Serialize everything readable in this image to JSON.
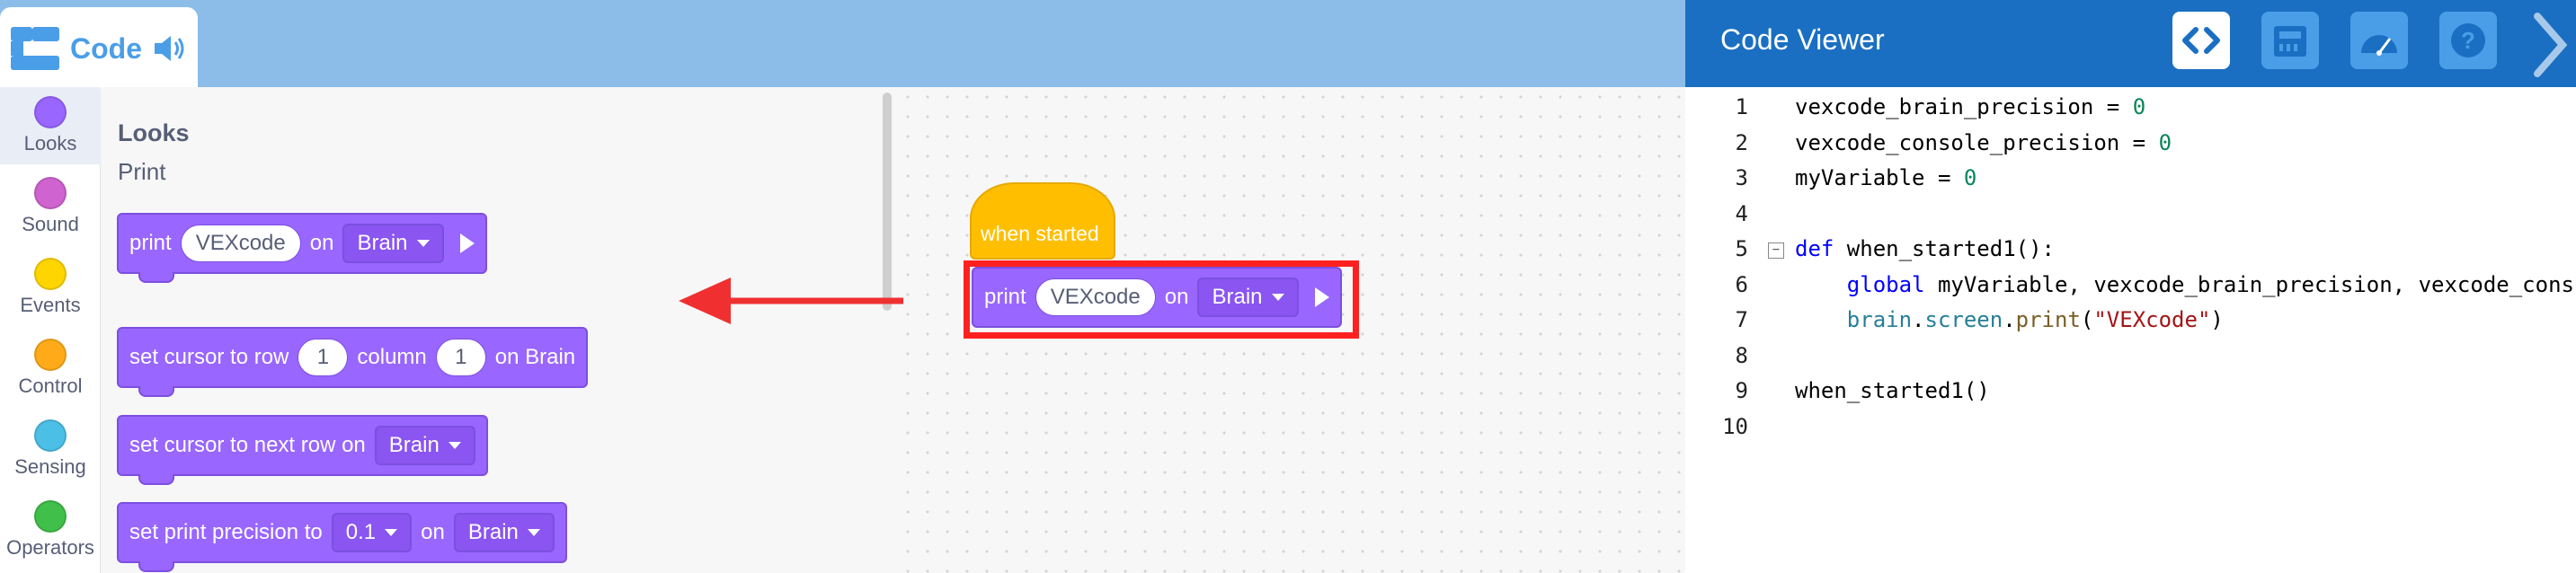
{
  "top_tab": {
    "label": "Code"
  },
  "categories": [
    {
      "label": "Looks",
      "color": "#9966ff",
      "selected": true
    },
    {
      "label": "Sound",
      "color": "#cf63cf",
      "selected": false
    },
    {
      "label": "Events",
      "color": "#ffd500",
      "selected": false
    },
    {
      "label": "Control",
      "color": "#ffab19",
      "selected": false
    },
    {
      "label": "Sensing",
      "color": "#4cbfe6",
      "selected": false
    },
    {
      "label": "Operators",
      "color": "#40bf4a",
      "selected": false
    }
  ],
  "flyout": {
    "title": "Looks",
    "subtitle": "Print",
    "blocks": {
      "print": {
        "kw": "print",
        "text": "VEXcode",
        "on": "on",
        "target": "Brain"
      },
      "cursor_row": {
        "label": "set cursor to row",
        "row": "1",
        "col_label": "column",
        "col": "1",
        "suffix": "on Brain"
      },
      "next_row": {
        "label": "set cursor to next row on",
        "target": "Brain"
      },
      "precision": {
        "label": "set print precision to",
        "value": "0.1",
        "on": "on",
        "target": "Brain"
      }
    }
  },
  "workspace": {
    "hat": {
      "label": "when started"
    },
    "print_block": {
      "kw": "print",
      "text": "VEXcode",
      "on": "on",
      "target": "Brain"
    }
  },
  "code_viewer": {
    "title": "Code Viewer",
    "lines": [
      {
        "n": "1",
        "parts": [
          {
            "t": "vexcode_brain_precision = ",
            "c": ""
          },
          {
            "t": "0",
            "c": "num"
          }
        ]
      },
      {
        "n": "2",
        "parts": [
          {
            "t": "vexcode_console_precision = ",
            "c": ""
          },
          {
            "t": "0",
            "c": "num"
          }
        ]
      },
      {
        "n": "3",
        "parts": [
          {
            "t": "myVariable = ",
            "c": ""
          },
          {
            "t": "0",
            "c": "num"
          }
        ]
      },
      {
        "n": "4",
        "parts": []
      },
      {
        "n": "5",
        "fold": true,
        "parts": [
          {
            "t": "def",
            "c": "kw"
          },
          {
            "t": " when_started1():",
            "c": ""
          }
        ]
      },
      {
        "n": "6",
        "parts": [
          {
            "t": "    ",
            "c": ""
          },
          {
            "t": "global",
            "c": "kw"
          },
          {
            "t": " myVariable, vexcode_brain_precision, vexcode_cons",
            "c": ""
          }
        ]
      },
      {
        "n": "7",
        "parts": [
          {
            "t": "    ",
            "c": ""
          },
          {
            "t": "brain",
            "c": "attr"
          },
          {
            "t": ".",
            "c": ""
          },
          {
            "t": "screen",
            "c": "attr"
          },
          {
            "t": ".",
            "c": ""
          },
          {
            "t": "print",
            "c": "fn"
          },
          {
            "t": "(",
            "c": ""
          },
          {
            "t": "\"VEXcode\"",
            "c": "str"
          },
          {
            "t": ")",
            "c": ""
          }
        ]
      },
      {
        "n": "8",
        "parts": []
      },
      {
        "n": "9",
        "parts": [
          {
            "t": "when_started1()",
            "c": ""
          }
        ]
      },
      {
        "n": "10",
        "parts": []
      }
    ]
  }
}
